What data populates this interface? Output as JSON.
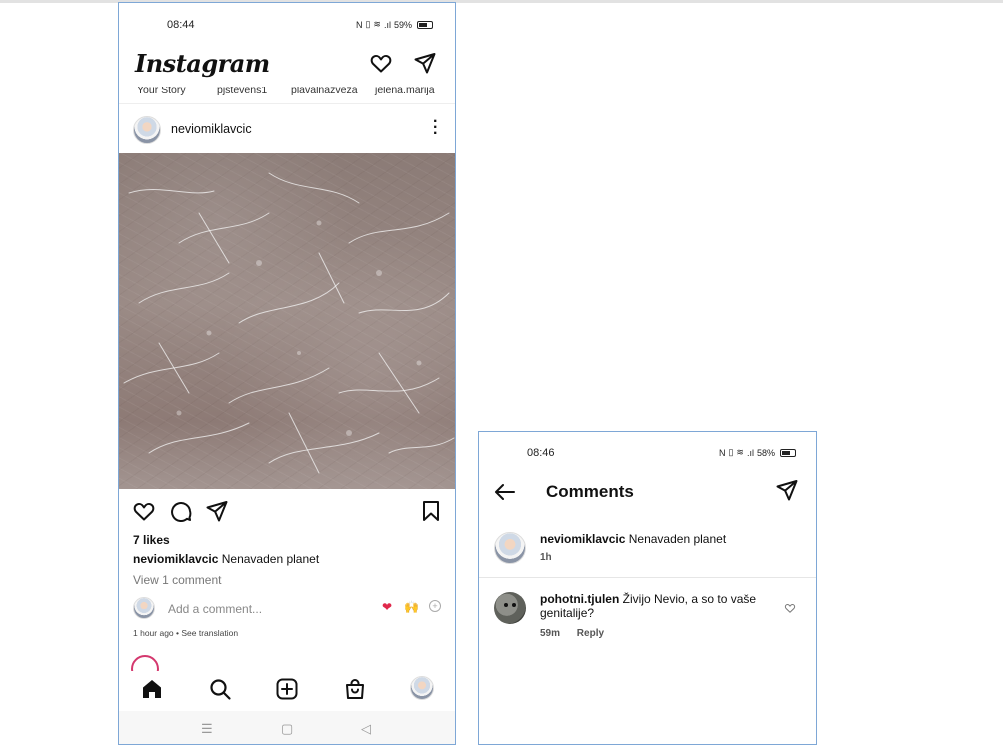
{
  "phone1": {
    "status": {
      "time": "08:44",
      "battery": "59%"
    },
    "header": {
      "logo": "Instagram"
    },
    "stories": [
      "Your Story",
      "pjstevens1",
      "plavalnazveza",
      "jelena.marija"
    ],
    "post": {
      "username": "neviomiklavcic",
      "likes": "7 likes",
      "caption_user": "neviomiklavcic",
      "caption_text": "Nenavaden planet",
      "view_comments": "View 1 comment",
      "add_comment_placeholder": "Add a comment...",
      "reactions": [
        "❤",
        "🙌"
      ],
      "time": "1 hour ago",
      "time_sep": " • ",
      "see_translation": "See translation"
    },
    "system_nav": [
      "☰",
      "▢",
      "◁"
    ]
  },
  "phone2": {
    "status": {
      "time": "08:46",
      "battery": "58%"
    },
    "header": {
      "title": "Comments"
    },
    "caption": {
      "username": "neviomiklavcic",
      "text": "Nenavaden planet",
      "age": "1h"
    },
    "comments": [
      {
        "username": "pohotni.tjulen",
        "text": "Živijo Nevio, a so to vaše genitalije?",
        "age": "59m",
        "reply": "Reply"
      }
    ]
  },
  "colors": {
    "accent_border": "#7ea7d6",
    "heart_red": "#e0284b",
    "story_ring": "#d4386e"
  }
}
